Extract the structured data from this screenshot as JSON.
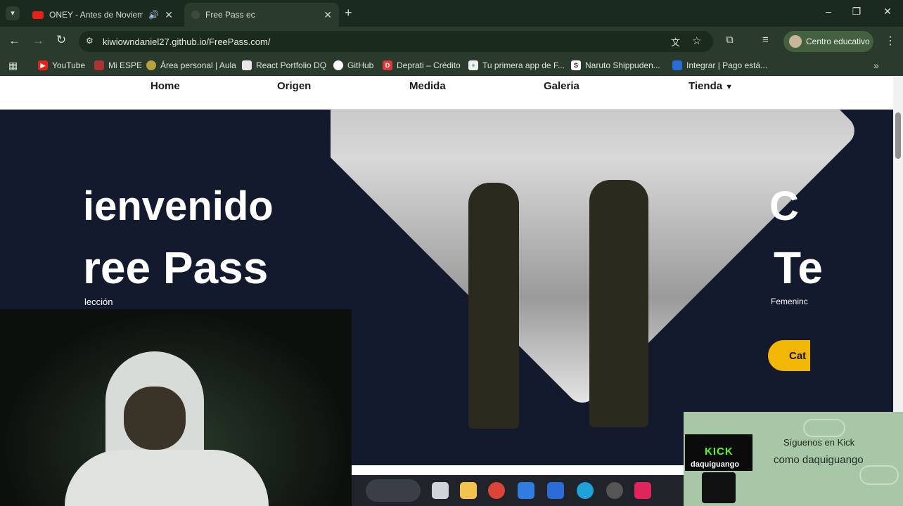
{
  "browser": {
    "tabs": [
      {
        "title": "ONEY - Antes de Noviembre",
        "active": false,
        "favicon": "youtube-icon",
        "audio": true
      },
      {
        "title": "Free Pass ec",
        "active": true,
        "favicon": "page-icon"
      }
    ],
    "new_tab": "+",
    "url": "kiwiowndaniel27.github.io/FreePass.com/",
    "profile_label": "Centro educativo",
    "bookmarks": [
      {
        "label": "YouTube",
        "icon": "youtube-icon",
        "color": "#e62117"
      },
      {
        "label": "Mi ESPE",
        "icon": "espe-icon",
        "color": "#c0392b"
      },
      {
        "label": "Área personal | Aula",
        "icon": "aula-icon",
        "color": "#b8a23a"
      },
      {
        "label": "React Portfolio DQ",
        "icon": "react-icon",
        "color": "#e8e8e8"
      },
      {
        "label": "GitHub",
        "icon": "github-icon",
        "color": "#ffffff"
      },
      {
        "label": "Deprati – Crédito",
        "icon": "deprati-icon",
        "color": "#d83a3a"
      },
      {
        "label": "Tu primera app de F...",
        "icon": "app-icon",
        "color": "#f0f0f0"
      },
      {
        "label": "Naruto Shippuden...",
        "icon": "naruto-icon",
        "color": "#ffffff"
      },
      {
        "label": "Integrar | Pago está...",
        "icon": "pago-icon",
        "color": "#2a6bd8"
      }
    ]
  },
  "site": {
    "nav": [
      "Home",
      "Origen",
      "Medida",
      "Galeria",
      "Tienda"
    ],
    "hero_left_line1": "ienvenido",
    "hero_left_line2": "ree Pass",
    "hero_left_sub": "lección",
    "hero_right_line1": "C",
    "hero_right_line2": "Te",
    "hero_right_sub": "Femeninc",
    "cta_label": "Cat"
  },
  "overlay": {
    "kick_logo": "KICK",
    "kick_user": "daquiguango",
    "follow_line1": "Síguenos en Kick",
    "follow_line2": "como daquiguango"
  },
  "colors": {
    "hero_bg": "#131a2e",
    "accent": "#f2b705",
    "kick_green": "#53fc18"
  }
}
